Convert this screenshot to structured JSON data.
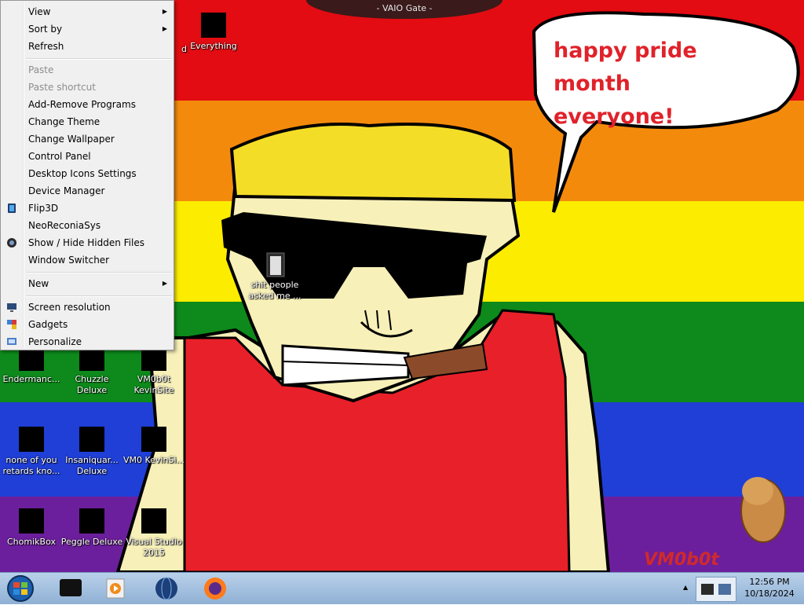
{
  "window": {
    "title": "- VAIO Gate -"
  },
  "wallpaper": {
    "speech_bubble": [
      "happy pride month",
      "everyone!"
    ],
    "watermark": "VM0b0t",
    "colors": [
      "#e20c12",
      "#f48a0c",
      "#fcec00",
      "#0d8a1b",
      "#1f3fd6",
      "#6c1f9c"
    ]
  },
  "context_menu": {
    "items": [
      {
        "label": "View",
        "submenu": true
      },
      {
        "label": "Sort by",
        "submenu": true
      },
      {
        "label": "Refresh"
      },
      {
        "label": "Paste",
        "disabled": true
      },
      {
        "label": "Paste shortcut",
        "disabled": true
      },
      {
        "label": "Add-Remove Programs"
      },
      {
        "label": "Change Theme"
      },
      {
        "label": "Change Wallpaper"
      },
      {
        "label": "Control Panel"
      },
      {
        "label": "Desktop Icons Settings"
      },
      {
        "label": "Device Manager"
      },
      {
        "label": "Flip3D",
        "icon": "flip3d-icon"
      },
      {
        "label": "NeoReconiaSys"
      },
      {
        "label": "Show / Hide Hidden Files",
        "icon": "hidden-files-icon"
      },
      {
        "label": "Window Switcher"
      },
      {
        "label": "New",
        "submenu": true
      },
      {
        "label": "Screen resolution",
        "icon": "monitor-icon"
      },
      {
        "label": "Gadgets",
        "icon": "gadgets-icon"
      },
      {
        "label": "Personalize",
        "icon": "personalize-icon"
      }
    ]
  },
  "desktop_icons": [
    {
      "label": "Everything",
      "icon": "everything-icon"
    },
    {
      "label": "d",
      "icon": "partial-icon"
    },
    {
      "label": "shit people asked me ...",
      "icon": "folder-icon"
    },
    {
      "label": "Endermanc...",
      "icon": "app-icon"
    },
    {
      "label": "Chuzzle Deluxe",
      "icon": "chuzzle-icon"
    },
    {
      "label": "VM0b0t KevinSite",
      "icon": "site-icon"
    },
    {
      "label": "none of you retards kno...",
      "icon": "app-icon"
    },
    {
      "label": "Insaniquar... Deluxe",
      "icon": "insaniquarium-icon"
    },
    {
      "label": "VM0 KevinSi...",
      "icon": "site-icon"
    },
    {
      "label": "ChomikBox",
      "icon": "chomikbox-icon"
    },
    {
      "label": "Peggle Deluxe",
      "icon": "peggle-icon"
    },
    {
      "label": "Visual Studio 2015",
      "icon": "visual-studio-icon"
    }
  ],
  "taskbar": {
    "buttons": [
      "start-orb-icon",
      "device-icon",
      "media-player-icon",
      "globe-icon",
      "firefox-icon"
    ],
    "clock": {
      "time": "12:56 PM",
      "date": "10/18/2024"
    }
  }
}
